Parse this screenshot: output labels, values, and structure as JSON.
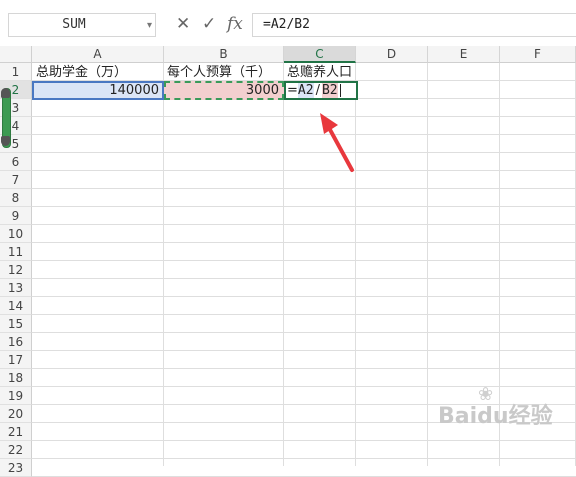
{
  "formula_bar": {
    "name_box": "SUM",
    "name_box_arrow": "▾",
    "cancel_icon": "✕",
    "confirm_icon": "✓",
    "fx_label": "fx",
    "formula": "=A2/B2"
  },
  "columns": [
    "A",
    "B",
    "C",
    "D",
    "E",
    "F"
  ],
  "rows": [
    "1",
    "2",
    "3",
    "4",
    "5",
    "6",
    "7",
    "8",
    "9",
    "10",
    "11",
    "12",
    "13",
    "14",
    "15",
    "16",
    "17",
    "18",
    "19",
    "20",
    "21",
    "22",
    "23"
  ],
  "cells": {
    "A1": "总助学金（万）",
    "B1": "每个人预算（千）",
    "C1": "总赡养人口",
    "A2": "140000",
    "B2": "3000",
    "C2_eq": "=",
    "C2_a2": "A2",
    "C2_slash": "/",
    "C2_b2": "B2"
  },
  "annotation": {
    "arrow_color": "#e8383d"
  },
  "watermark": {
    "text": "Baidu经验",
    "icon": "paw-icon"
  },
  "colors": {
    "accent": "#217346",
    "ref_a": "#4a78c2",
    "ref_b": "#f3cfcf"
  }
}
